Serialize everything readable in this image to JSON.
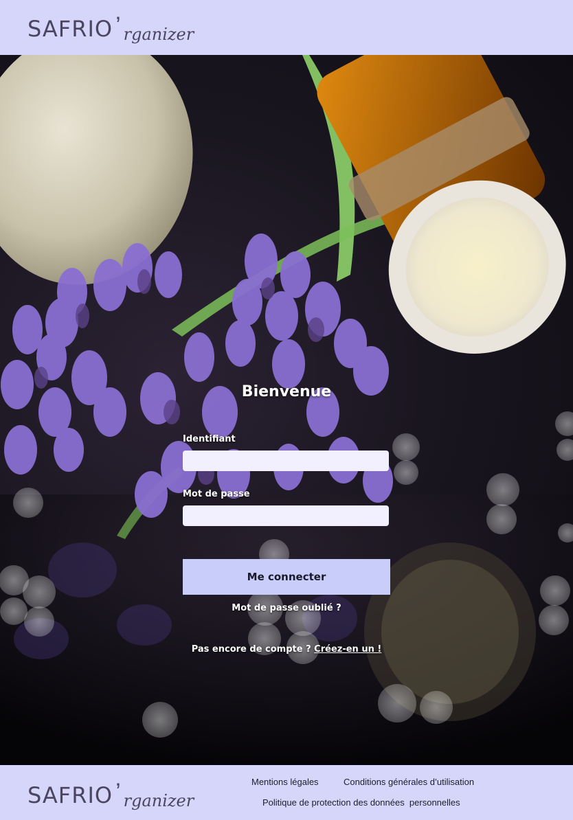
{
  "header": {
    "brand": "SAFRIO",
    "apostrophe": "’",
    "script": "rganizer"
  },
  "login": {
    "title": "Bienvenue",
    "identifier_label": "Identifiant",
    "identifier_value": "",
    "password_label": "Mot de passe",
    "password_value": "",
    "submit_label": "Me connecter",
    "forgot_label": "Mot de passe oublié ?",
    "signup_prefix": "Pas encore de compte ?",
    "signup_link": "Créez-en un !"
  },
  "footer": {
    "brand": "SAFRIO",
    "apostrophe": "’",
    "script": "rganizer",
    "links": [
      "Mentions légales",
      "Conditions générales d’utilisation",
      "Politique de protection des données  personnelles"
    ]
  },
  "colors": {
    "header_bg": "#d6d6fa",
    "button_bg": "#c9cdfa",
    "input_bg": "#f2f0ff",
    "text_dark": "#4a4560"
  }
}
